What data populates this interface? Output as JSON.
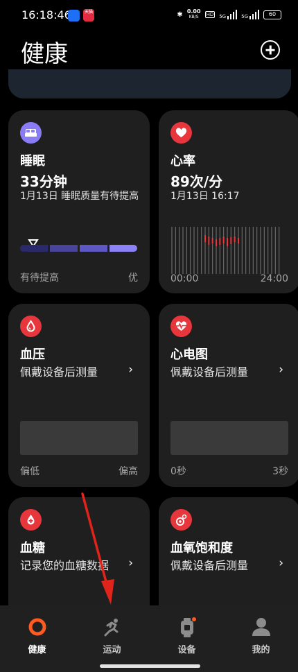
{
  "status_bar": {
    "time": "16:18:46",
    "app2_label": "天猫",
    "speed_value": "0.00",
    "speed_unit": "KB/S",
    "hd": "HD",
    "net1": "5G",
    "net2": "5G",
    "battery": "60"
  },
  "header": {
    "title": "健康"
  },
  "cards": {
    "sleep": {
      "title": "睡眠",
      "value": "33分钟",
      "subtitle": "1月13日 睡眠质量有待提高",
      "legend_left": "有待提高",
      "legend_right": "优",
      "icon_color": "#8a7cf5",
      "bar_colors": [
        "#2a2a6b",
        "#47449a",
        "#5d58c4",
        "#8a82f5"
      ]
    },
    "heart_rate": {
      "title": "心率",
      "value": "89次/分",
      "subtitle": "1月13日 16:17",
      "legend_left": "00:00",
      "legend_right": "24:00",
      "icon_color": "#e8363d"
    },
    "blood_pressure": {
      "title": "血压",
      "subtitle": "佩戴设备后测量",
      "legend_left": "偏低",
      "legend_right": "偏高",
      "icon_color": "#e8363d"
    },
    "ecg": {
      "title": "心电图",
      "subtitle": "佩戴设备后测量",
      "legend_left": "0秒",
      "legend_right": "3秒",
      "icon_color": "#e8363d"
    },
    "blood_sugar": {
      "title": "血糖",
      "subtitle": "记录您的血糖数据",
      "icon_color": "#e8363d"
    },
    "spo2": {
      "title": "血氧饱和度",
      "subtitle": "佩戴设备后测量",
      "icon_color": "#e8363d"
    }
  },
  "nav": {
    "items": [
      {
        "label": "健康",
        "active": true
      },
      {
        "label": "运动",
        "active": false
      },
      {
        "label": "设备",
        "active": false
      },
      {
        "label": "我的",
        "active": false
      }
    ],
    "accent": "#ff5a1f"
  }
}
